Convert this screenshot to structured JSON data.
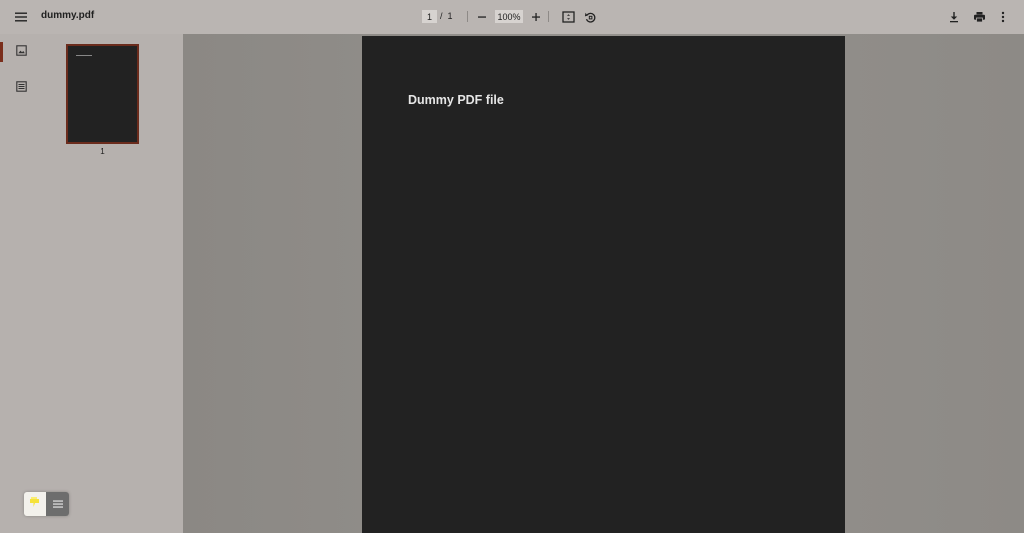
{
  "toolbar": {
    "menu_icon": "hamburger-menu-icon",
    "filename": "dummy.pdf",
    "page_current": "1",
    "page_separator": "/",
    "page_total": "1",
    "zoom_out_icon": "minus-icon",
    "zoom_value": "100%",
    "zoom_in_icon": "plus-icon",
    "fit_icon": "fit-to-page-icon",
    "rotate_icon": "rotate-counterclockwise-icon",
    "download_icon": "download-icon",
    "print_icon": "print-icon",
    "more_icon": "more-vert-icon"
  },
  "sidebar": {
    "tabs": [
      {
        "name": "thumbnails",
        "icon": "image-icon",
        "active": true
      },
      {
        "name": "outline",
        "icon": "list-icon",
        "active": false
      }
    ],
    "thumbnails": [
      {
        "page_label": "1",
        "selected": true
      }
    ]
  },
  "document": {
    "pages": [
      {
        "heading": "Dummy PDF file"
      }
    ]
  },
  "colors": {
    "toolbar_bg": "#bab5b2",
    "sidebar_bg": "#b6b1ae",
    "viewer_bg": "#8f8c88",
    "page_bg": "#222222",
    "accent": "#7a2e1c"
  },
  "widget": {
    "left_icon": "sticky-note-icon",
    "right_icon": "lines-menu-icon"
  }
}
